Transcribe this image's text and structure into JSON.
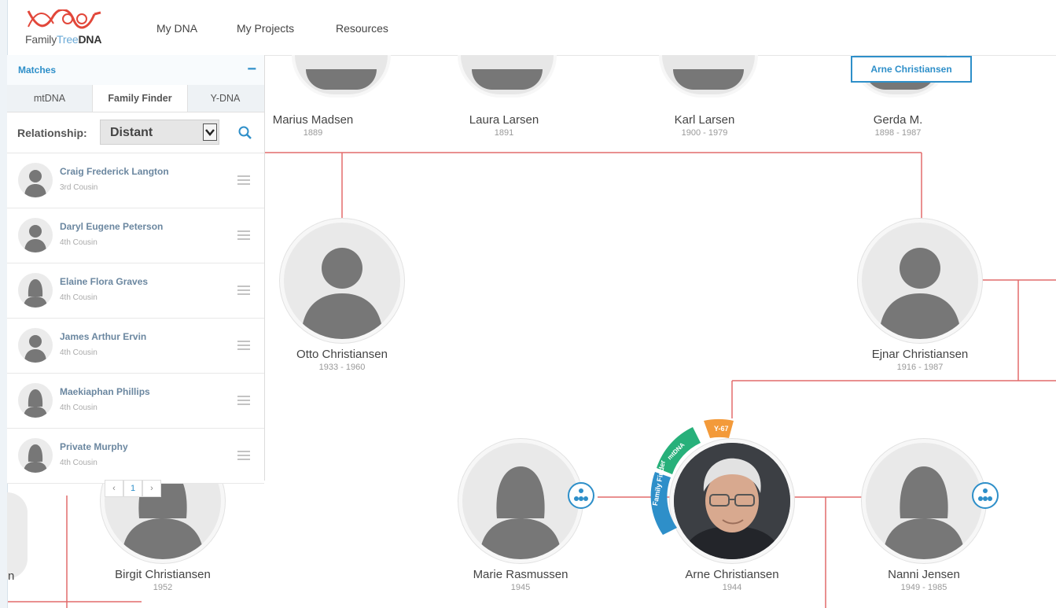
{
  "header": {
    "logo_text_a": "Family",
    "logo_text_b": "Tree",
    "logo_text_c": "DNA",
    "nav": [
      "My DNA",
      "My Projects",
      "Resources"
    ]
  },
  "focus_person": "Arne Christiansen",
  "panel": {
    "title": "Matches",
    "collapse": "−",
    "tabs": [
      "mtDNA",
      "Family Finder",
      "Y-DNA"
    ],
    "active_tab": "Family Finder",
    "relationship_label": "Relationship:",
    "relationship_value": "Distant",
    "matches": [
      {
        "name": "Craig Frederick Langton",
        "relation": "3rd Cousin"
      },
      {
        "name": "Daryl Eugene Peterson",
        "relation": "4th Cousin"
      },
      {
        "name": "Elaine Flora Graves",
        "relation": "4th Cousin"
      },
      {
        "name": "James Arthur Ervin",
        "relation": "4th Cousin"
      },
      {
        "name": "Maekiaphan Phillips",
        "relation": "4th Cousin"
      },
      {
        "name": "Private Murphy",
        "relation": "4th Cousin"
      }
    ],
    "pager": {
      "prev": "‹",
      "page": "1",
      "next": "›"
    }
  },
  "tree": {
    "top_row": [
      {
        "name": "Marius Madsen",
        "years": "1889"
      },
      {
        "name": "Laura Larsen",
        "years": "1891"
      },
      {
        "name": "Karl Larsen",
        "years": "1900 - 1979"
      },
      {
        "name": "Gerda M.",
        "years": "1898 - 1987"
      }
    ],
    "parents": [
      {
        "name": "Otto Christiansen",
        "years": "1933 - 1960"
      },
      {
        "name": "Ejnar Christiansen",
        "years": "1916 - 1987"
      }
    ],
    "bottom_row": [
      {
        "name": "Birgit Christiansen",
        "years": "1952"
      },
      {
        "name": "Marie Rasmussen",
        "years": "1945"
      },
      {
        "name": "Arne Christiansen",
        "years": "1944"
      },
      {
        "name": "Nanni Jensen",
        "years": "1949 - 1985"
      }
    ],
    "partial_left_letter": "n",
    "dna_tags": [
      "Family Finder",
      "mtDNA",
      "Y-67"
    ]
  },
  "colors": {
    "accent": "#2e8fc9",
    "line": "#e26b6b",
    "green": "#27b07a",
    "orange": "#f39a3a",
    "silhouette": "#777777"
  }
}
